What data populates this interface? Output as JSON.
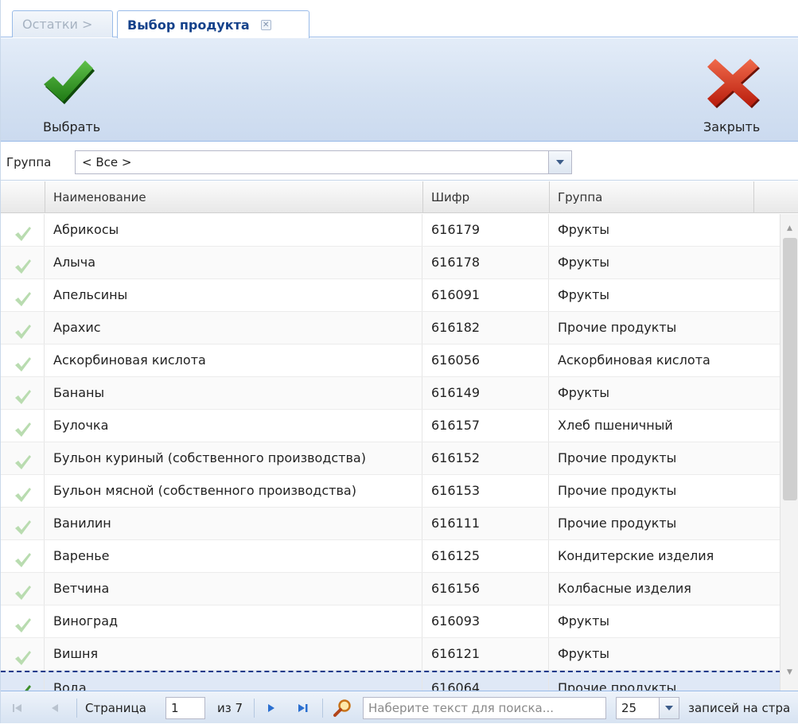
{
  "tabs": [
    {
      "label": "Остатки >",
      "active": false
    },
    {
      "label": "Выбор продукта",
      "active": true
    }
  ],
  "toolbar": {
    "select_label": "Выбрать",
    "select_icon": "check-icon",
    "close_label": "Закрыть",
    "close_icon": "close-x-icon"
  },
  "filter": {
    "label": "Группа",
    "value": "< Все >"
  },
  "grid": {
    "columns": [
      "Наименование",
      "Шифр",
      "Группа"
    ],
    "rows": [
      {
        "name": "Абрикосы",
        "code": "616179",
        "group": "Фрукты"
      },
      {
        "name": "Алыча",
        "code": "616178",
        "group": "Фрукты"
      },
      {
        "name": "Апельсины",
        "code": "616091",
        "group": "Фрукты"
      },
      {
        "name": "Арахис",
        "code": "616182",
        "group": "Прочие продукты"
      },
      {
        "name": "Аскорбиновая кислота",
        "code": "616056",
        "group": "Аскорбиновая кислота"
      },
      {
        "name": "Бананы",
        "code": "616149",
        "group": "Фрукты"
      },
      {
        "name": "Булочка",
        "code": "616157",
        "group": "Хлеб пшеничный"
      },
      {
        "name": "Бульон куриный (собственного производства)",
        "code": "616152",
        "group": "Прочие продукты"
      },
      {
        "name": "Бульон мясной (собственного производства)",
        "code": "616153",
        "group": "Прочие продукты"
      },
      {
        "name": "Ванилин",
        "code": "616111",
        "group": "Прочие продукты"
      },
      {
        "name": "Варенье",
        "code": "616125",
        "group": "Кондитерские изделия"
      },
      {
        "name": "Ветчина",
        "code": "616156",
        "group": "Колбасные изделия"
      },
      {
        "name": "Виноград",
        "code": "616093",
        "group": "Фрукты"
      },
      {
        "name": "Вишня",
        "code": "616121",
        "group": "Фрукты"
      },
      {
        "name": "Вода",
        "code": "616064",
        "group": "Прочие продукты",
        "selected": true
      }
    ]
  },
  "pager": {
    "page_label": "Страница",
    "page_value": "1",
    "of_label": "из 7",
    "search_placeholder": "Наберите текст для поиска...",
    "page_size": "25",
    "per_page_label": "записей на стра"
  },
  "colors": {
    "accent_blue": "#15428b",
    "check_green": "#2e8b1e",
    "close_red": "#d9301b",
    "toolbar_bg": "#d4e1f2"
  }
}
